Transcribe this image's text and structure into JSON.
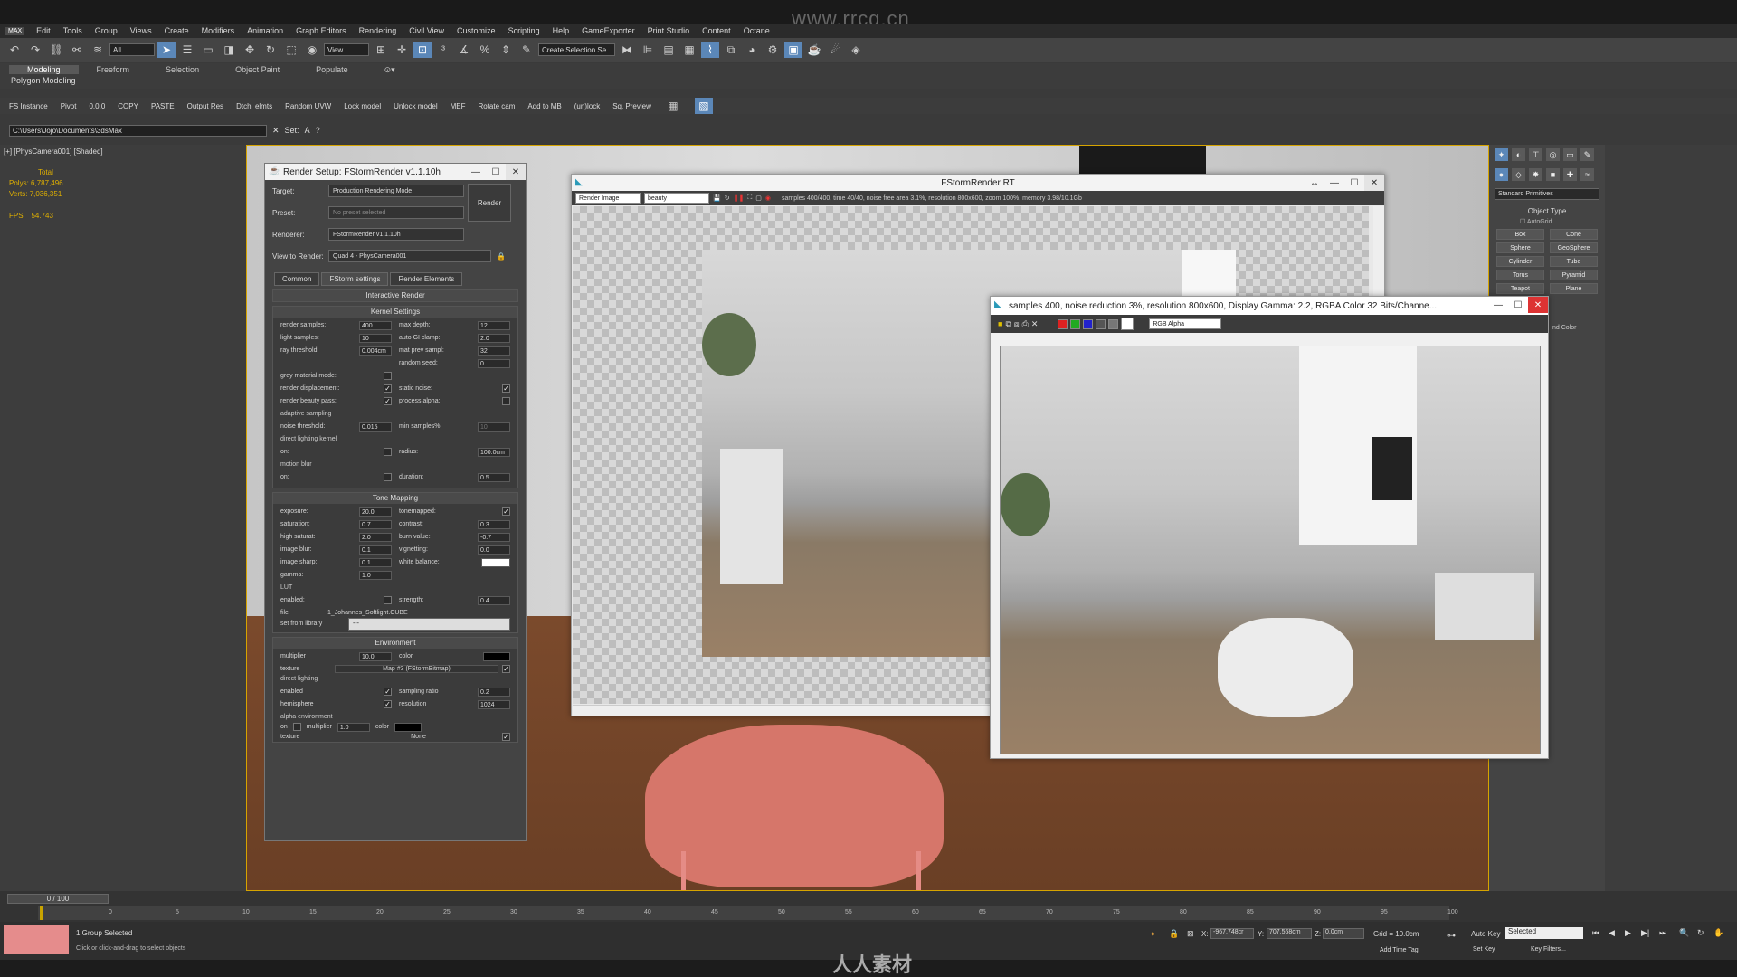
{
  "watermark": "www.rrcg.cn",
  "menu": {
    "logo": "MAX",
    "items": [
      "Edit",
      "Tools",
      "Group",
      "Views",
      "Create",
      "Modifiers",
      "Animation",
      "Graph Editors",
      "Rendering",
      "Civil View",
      "Customize",
      "Scripting",
      "Help",
      "GameExporter",
      "Print Studio",
      "Content",
      "Octane"
    ]
  },
  "toolbar": {
    "selection_filter": "All",
    "ref_coord": "View",
    "named_selection": "Create Selection Se"
  },
  "ribbon": {
    "tabs": [
      "Modeling",
      "Freeform",
      "Selection",
      "Object Paint",
      "Populate"
    ],
    "active_tab": "Modeling",
    "sub_label": "Polygon Modeling",
    "buttons": [
      "FS Instance",
      "Pivot",
      "0,0,0",
      "COPY",
      "PASTE",
      "Output Res",
      "Dtch. elmts",
      "Random UVW",
      "Lock model",
      "Unlock model",
      "MEF",
      "Rotate cam",
      "Add to MB",
      "(un)lock",
      "Sq. Preview"
    ]
  },
  "path_bar": {
    "path": "C:\\Users\\Jojo\\Documents\\3dsMax",
    "set_label": "Set:",
    "set_a": "A",
    "set_q": "?"
  },
  "viewport": {
    "label": "[+] [PhysCamera001] [Shaded]",
    "stats": {
      "total_label": "Total",
      "polys_label": "Polys:",
      "polys_value": "6,787,496",
      "verts_label": "Verts:",
      "verts_value": "7,036,351",
      "fps_label": "FPS:",
      "fps_value": "54.743"
    }
  },
  "render_setup": {
    "title": "Render Setup: FStormRender v1.1.10h",
    "target_label": "Target:",
    "target_value": "Production Rendering Mode",
    "preset_label": "Preset:",
    "preset_value": "No preset selected",
    "renderer_label": "Renderer:",
    "renderer_value": "FStormRender v1.1.10h",
    "view_label": "View to Render:",
    "view_value": "Quad 4 - PhysCamera001",
    "render_button": "Render",
    "tabs": [
      "Common",
      "FStorm settings",
      "Render Elements"
    ],
    "interactive_render": "Interactive Render",
    "kernel": {
      "header": "Kernel Settings",
      "params": [
        {
          "k": "render samples:",
          "v": "400"
        },
        {
          "k": "max depth:",
          "v": "12"
        },
        {
          "k": "light samples:",
          "v": "10"
        },
        {
          "k": "auto GI clamp:",
          "v": "2.0"
        },
        {
          "k": "ray threshold:",
          "v": "0.004cm"
        },
        {
          "k": "mat prev sampl:",
          "v": "32"
        }
      ],
      "random_seed_label": "random seed:",
      "random_seed_value": "0",
      "checks": [
        {
          "k": "grey material mode:",
          "on": false
        },
        {
          "k": "",
          "on": null
        },
        {
          "k": "render displacement:",
          "on": true
        },
        {
          "k": "static noise:",
          "on": true
        },
        {
          "k": "render beauty pass:",
          "on": true
        },
        {
          "k": "process alpha:",
          "on": false
        }
      ],
      "adaptive_label": "adaptive sampling",
      "noise_threshold_label": "noise threshold:",
      "noise_threshold_value": "0.015",
      "min_samples_label": "min samples%:",
      "min_samples_value": "10",
      "direct_kernel_label": "direct lighting kernel",
      "on_label": "on:",
      "radius_label": "radius:",
      "radius_value": "100.0cm",
      "motion_blur_label": "motion blur",
      "duration_label": "duration:",
      "duration_value": "0.5"
    },
    "tone": {
      "header": "Tone Mapping",
      "params": [
        {
          "k": "exposure:",
          "v": "20.0"
        },
        {
          "k": "tonemapped:",
          "v": "✓"
        },
        {
          "k": "saturation:",
          "v": "0.7"
        },
        {
          "k": "contrast:",
          "v": "0.3"
        },
        {
          "k": "high saturat:",
          "v": "2.0"
        },
        {
          "k": "burn value:",
          "v": "-0.7"
        },
        {
          "k": "image blur:",
          "v": "0.1"
        },
        {
          "k": "vignetting:",
          "v": "0.0"
        },
        {
          "k": "image sharp:",
          "v": "0.1"
        },
        {
          "k": "white balance:",
          "v": ""
        },
        {
          "k": "gamma:",
          "v": "1.0"
        },
        {
          "k": "",
          "v": ""
        }
      ],
      "lut_label": "LUT",
      "enabled_label": "enabled:",
      "strength_label": "strength:",
      "strength_value": "0.4",
      "file_label": "file",
      "file_value": "1_Johannes_Softlight.CUBE",
      "set_from_library_label": "set from library",
      "set_from_library_value": "---"
    },
    "environment": {
      "header": "Environment",
      "multiplier_label": "multiplier",
      "multiplier_value": "10.0",
      "color_label": "color",
      "texture_label": "texture",
      "texture_value": "Map #3 (FStormBitmap)",
      "direct_lighting_label": "direct lighting",
      "enabled_label": "enabled",
      "sampling_ratio_label": "sampling ratio",
      "sampling_ratio_value": "0.2",
      "hemisphere_label": "hemisphere",
      "resolution_label": "resolution",
      "resolution_value": "1024",
      "alpha_env_label": "alpha environment",
      "on_label": "on",
      "alpha_multiplier_label": "multiplier",
      "alpha_multiplier_value": "1.0",
      "alpha_color_label": "color",
      "alpha_texture_label": "texture",
      "alpha_texture_value": "None"
    }
  },
  "fstorm_rt": {
    "title": "FStormRender RT",
    "channel_value": "Render Image",
    "pass_value": "beauty",
    "status": "samples 400/400, time 40/40, noise free area 3.1%, resolution 800x600, zoom 100%, memory 3.98/10.1Gb"
  },
  "frame_buffer": {
    "title": "samples 400, noise reduction 3%, resolution 800x600, Display Gamma: 2.2, RGBA Color 32 Bits/Channe...",
    "channel_value": "RGB Alpha"
  },
  "command_panel": {
    "category": "Standard Primitives",
    "object_type": "Object Type",
    "autogrid": "AutoGrid",
    "buttons": [
      "Box",
      "Cone",
      "Sphere",
      "GeoSphere",
      "Cylinder",
      "Tube",
      "Torus",
      "Pyramid",
      "Teapot",
      "Plane"
    ],
    "color_label": "nd Color"
  },
  "timeline": {
    "frame_counter": "0 / 100",
    "ticks": [
      "0",
      "5",
      "10",
      "15",
      "20",
      "25",
      "30",
      "35",
      "40",
      "45",
      "50",
      "55",
      "60",
      "65",
      "70",
      "75",
      "80",
      "85",
      "90",
      "95",
      "100"
    ]
  },
  "status": {
    "selection": "1 Group Selected",
    "prompt": "Click or click-and-drag to select objects",
    "x_label": "X:",
    "x_value": "-967.748cr",
    "y_label": "Y:",
    "y_value": "707.568cm",
    "z_label": "Z:",
    "z_value": "0.0cm",
    "grid": "Grid = 10.0cm",
    "add_time_tag": "Add Time Tag",
    "auto_key": "Auto Key",
    "selected": "Selected",
    "set_key": "Set Key",
    "key_filters": "Key Filters..."
  },
  "bottom_logo": "人人素材"
}
